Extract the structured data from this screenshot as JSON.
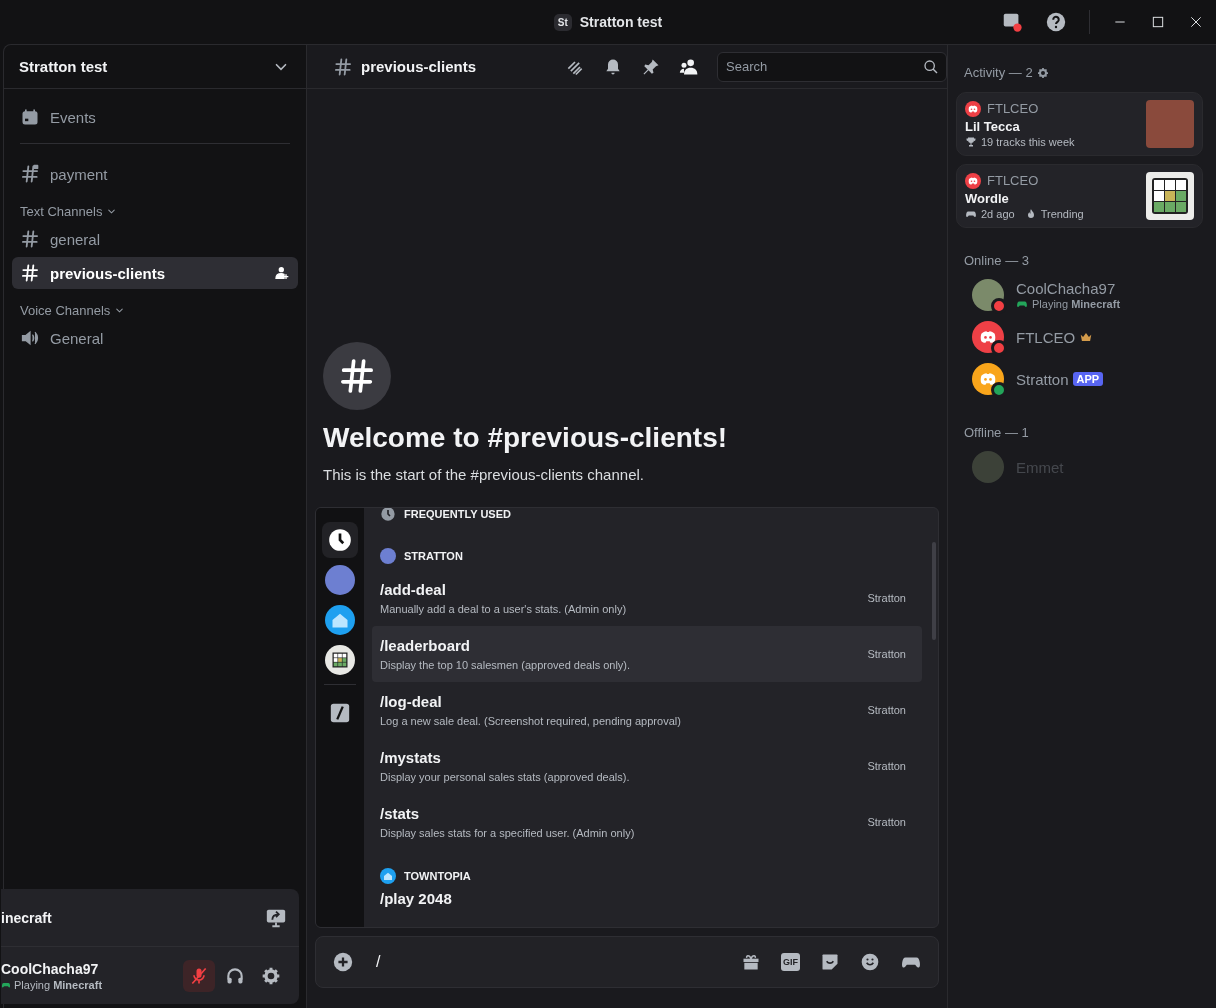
{
  "titlebar": {
    "badge": "St",
    "title": "Stratton test"
  },
  "sidebar": {
    "server_name": "Stratton test",
    "events": "Events",
    "top_channels": [
      {
        "kind": "locked",
        "name": "payment",
        "selected": false
      }
    ],
    "categories": [
      {
        "name": "Text Channels",
        "channels": [
          {
            "kind": "text",
            "name": "general",
            "selected": false
          },
          {
            "kind": "text",
            "name": "previous-clients",
            "selected": true
          }
        ]
      },
      {
        "name": "Voice Channels",
        "channels": [
          {
            "kind": "voice",
            "name": "General",
            "selected": false
          }
        ]
      }
    ]
  },
  "user_panel": {
    "activity": "inecraft",
    "username": "CoolChacha97",
    "status": "Playing **Minecraft**",
    "muted": true
  },
  "channel_header": {
    "name": "previous-clients",
    "search_placeholder": "Search"
  },
  "welcome": {
    "title": "Welcome to #previous-clients!",
    "subtitle": "This is the start of the #previous-clients channel."
  },
  "command_picker": {
    "rail": [
      {
        "kind": "recent",
        "selected": true
      },
      {
        "kind": "app",
        "color": "#6d7fd1",
        "selected": false
      },
      {
        "kind": "house",
        "color": "#1ea0f0",
        "selected": false
      },
      {
        "kind": "grid",
        "color": "#e8e8e4",
        "selected": false
      },
      {
        "kind": "builtin",
        "selected": false
      }
    ],
    "sections": [
      {
        "kind": "recent",
        "title": "FREQUENTLY USED"
      },
      {
        "kind": "app",
        "color": "#6d7fd1",
        "title": "STRATTON",
        "commands": [
          {
            "name": "/add-deal",
            "description": "Manually add a deal to a user's stats. (Admin only)",
            "source": "Stratton",
            "selected": false
          },
          {
            "name": "/leaderboard",
            "description": "Display the top 10 salesmen (approved deals only).",
            "source": "Stratton",
            "selected": true
          },
          {
            "name": "/log-deal",
            "description": "Log a new sale deal. (Screenshot required, pending approval)",
            "source": "Stratton",
            "selected": false
          },
          {
            "name": "/mystats",
            "description": "Display your personal sales stats (approved deals).",
            "source": "Stratton",
            "selected": false
          },
          {
            "name": "/stats",
            "description": "Display sales stats for a specified user. (Admin only)",
            "source": "Stratton",
            "selected": false
          }
        ]
      },
      {
        "kind": "house",
        "color": "#1ea0f0",
        "title": "TOWNTOPIA",
        "commands": [
          {
            "name": "/play 2048",
            "selected": false
          }
        ]
      }
    ]
  },
  "composer": {
    "value": "/",
    "gif_label": "GIF"
  },
  "activity": {
    "title": "Activity — 2",
    "cards": [
      {
        "user": "FTLCEO",
        "title": "Lil Tecca",
        "kind": "photo",
        "details": [
          {
            "kind": "trophy",
            "text": "19 tracks this week"
          }
        ]
      },
      {
        "user": "FTLCEO",
        "title": "Wordle",
        "kind": "grid",
        "details": [
          {
            "kind": "gamepad",
            "text": "2d ago"
          },
          {
            "kind": "fire",
            "text": "Trending"
          }
        ]
      }
    ]
  },
  "member_groups": [
    {
      "title": "Online — 3",
      "members": [
        {
          "name": "CoolChacha97",
          "avatar": {
            "kind": "photo"
          },
          "status_dot": {
            "color": "#f23f43"
          },
          "offline": false,
          "activity": "Playing **Minecraft**"
        },
        {
          "name": "FTLCEO",
          "avatar": {
            "kind": "logo",
            "color": "#ee4046"
          },
          "status_dot": {
            "color": "#f23f43"
          },
          "offline": false,
          "owner": true
        },
        {
          "name": "Stratton",
          "avatar": {
            "kind": "logo",
            "color": "#f9a51b"
          },
          "status_dot": {
            "color": "#23a55a"
          },
          "offline": false,
          "badge": "APP"
        }
      ]
    },
    {
      "title": "Offline — 1",
      "members": [
        {
          "name": "Emmet",
          "avatar": {
            "kind": "photo"
          },
          "offline": true
        }
      ]
    }
  ]
}
